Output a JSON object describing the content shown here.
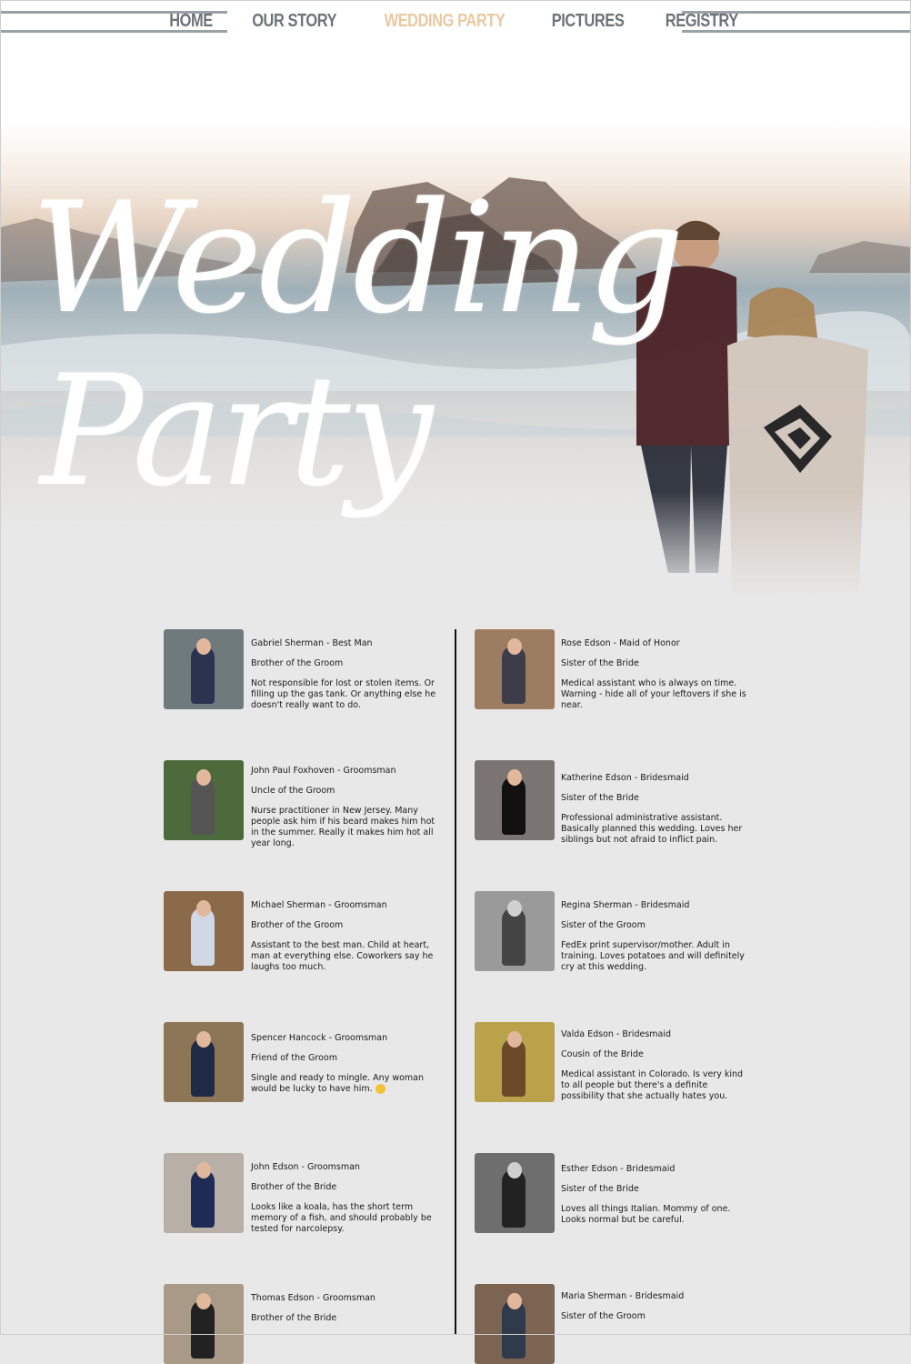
{
  "nav": {
    "items": [
      {
        "label": "HOME"
      },
      {
        "label": "OUR STORY"
      },
      {
        "label": "WEDDING PARTY"
      },
      {
        "label": "PICTURES"
      },
      {
        "label": "REGISTRY"
      }
    ],
    "active_index": 2,
    "colors": {
      "inactive": "#6d7377",
      "active": "#e7c9a2",
      "rule": "#9aa1a5"
    }
  },
  "hero": {
    "title_line1": "Wedding",
    "title_line2": "Party"
  },
  "groomsmen": [
    {
      "name_role": "Gabriel Sherman - Best Man",
      "relation": "Brother of the Groom",
      "bio": "Not responsible for lost or stolen items. Or filling up the gas tank. Or anything else he doesn't really want to do."
    },
    {
      "name_role": "John Paul Foxhoven - Groomsman",
      "relation": "Uncle of the Groom",
      "bio": "Nurse practitioner in New Jersey. Many people ask him if his beard makes him hot in the summer. Really it makes him hot all year long."
    },
    {
      "name_role": "Michael Sherman - Groomsman",
      "relation": "Brother of the Groom",
      "bio": "Assistant to the best man. Child at heart, man at everything else. Coworkers say he laughs too much."
    },
    {
      "name_role": "Spencer Hancock - Groomsman",
      "relation": "Friend of the Groom",
      "bio": "Single and ready to mingle. Any woman would be lucky to have him."
    },
    {
      "name_role": "John Edson - Groomsman",
      "relation": "Brother of the Bride",
      "bio": "Looks like a koala, has the short term memory of a fish, and should probably be tested for narcolepsy."
    },
    {
      "name_role": "Thomas Edson - Groomsman",
      "relation": "Brother of the Bride",
      "bio": ""
    }
  ],
  "bridesmaids": [
    {
      "name_role": "Rose Edson - Maid of Honor",
      "relation": "Sister of the Bride",
      "bio": "Medical assistant who is always on time. Warning - hide all of your leftovers if she is near."
    },
    {
      "name_role": "Katherine Edson - Bridesmaid",
      "relation": "Sister of the Bride",
      "bio": "Professional administrative assistant. Basically planned this wedding. Loves her siblings but not afraid to inflict pain."
    },
    {
      "name_role": "Regina Sherman - Bridesmaid",
      "relation": "Sister of the Groom",
      "bio": "FedEx print supervisor/mother. Adult in training. Loves potatoes and will definitely cry at this wedding."
    },
    {
      "name_role": "Valda Edson - Bridesmaid",
      "relation": "Cousin of the Bride",
      "bio": "Medical assistant in Colorado. Is very kind to all people but there's a definite possibility that she actually hates you."
    },
    {
      "name_role": "Esther Edson - Bridesmaid",
      "relation": "Sister of the Bride",
      "bio": "Loves all things Italian. Mommy of one. Looks normal but be careful."
    },
    {
      "name_role": "Maria Sherman - Bridesmaid",
      "relation": "Sister of the Groom",
      "bio": ""
    }
  ]
}
